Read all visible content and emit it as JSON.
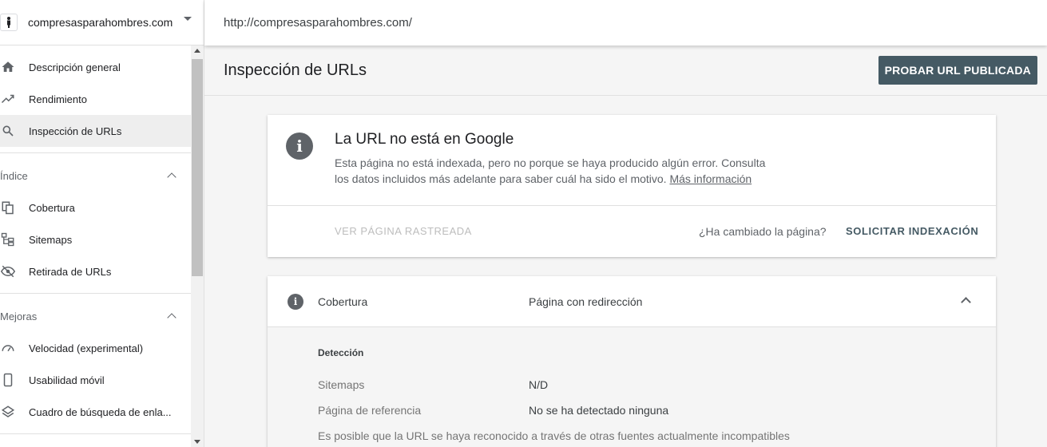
{
  "property": {
    "name": "compresasparahombres.com"
  },
  "url_bar": {
    "url": "http://compresasparahombres.com/"
  },
  "sidebar": {
    "items": [
      {
        "label": "Descripción general",
        "icon": "home-icon"
      },
      {
        "label": "Rendimiento",
        "icon": "trending-up-icon"
      },
      {
        "label": "Inspección de URLs",
        "icon": "search-icon",
        "active": true
      }
    ],
    "section_index": {
      "title": "Índice",
      "items": [
        {
          "label": "Cobertura",
          "icon": "copy-pages-icon"
        },
        {
          "label": "Sitemaps",
          "icon": "sitemap-icon"
        },
        {
          "label": "Retirada de URLs",
          "icon": "eye-off-icon"
        }
      ]
    },
    "section_improvements": {
      "title": "Mejoras",
      "items": [
        {
          "label": "Velocidad (experimental)",
          "icon": "speedometer-icon"
        },
        {
          "label": "Usabilidad móvil",
          "icon": "smartphone-icon"
        },
        {
          "label": "Cuadro de búsqueda de enla...",
          "icon": "layers-icon"
        }
      ]
    }
  },
  "header": {
    "title": "Inspección de URLs",
    "test_button": "PROBAR URL PUBLICADA"
  },
  "status_card": {
    "title": "La URL no está en Google",
    "desc_line1": "Esta página no está indexada, pero no porque se haya producido algún error. Consulta",
    "desc_line2": "los datos incluidos más adelante para saber cuál ha sido el motivo.",
    "learn_more": "Más información",
    "view_crawled": "VER PÁGINA RASTREADA",
    "changed_question": "¿Ha cambiado la página?",
    "request_indexing": "SOLICITAR INDEXACIÓN"
  },
  "coverage": {
    "label": "Cobertura",
    "value": "Página con redirección",
    "detection_title": "Detección",
    "rows": [
      {
        "label": "Sitemaps",
        "value": "N/D"
      },
      {
        "label": "Página de referencia",
        "value": "No se ha detectado ninguna"
      }
    ],
    "note": "Es posible que la URL se haya reconocido a través de otras fuentes actualmente incompatibles"
  },
  "colors": {
    "button_primary": "#455a64",
    "sidebar_active": "#eeeeee",
    "icon_grey": "#5f6368"
  }
}
